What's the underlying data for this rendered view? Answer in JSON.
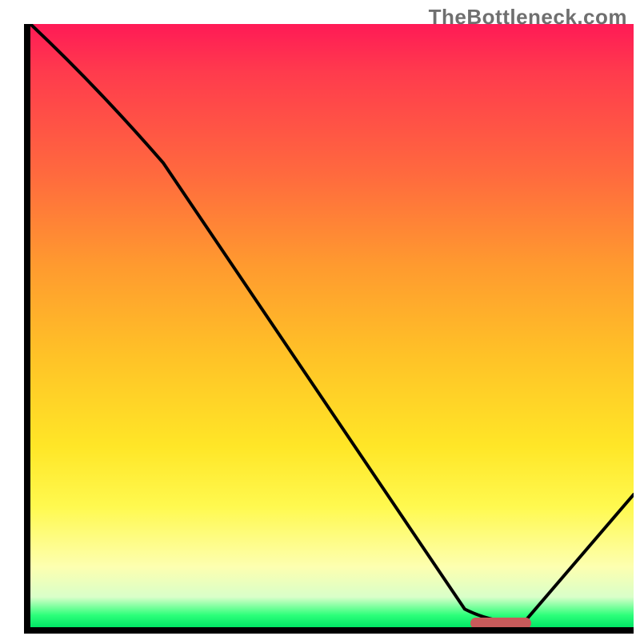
{
  "watermark": "TheBottleneck.com",
  "chart_data": {
    "type": "line",
    "title": "",
    "xlabel": "",
    "ylabel": "",
    "xlim": [
      0,
      100
    ],
    "ylim": [
      0,
      100
    ],
    "grid": false,
    "background_gradient": {
      "stops": [
        {
          "pos": 0,
          "color": "#ff1a56"
        },
        {
          "pos": 25,
          "color": "#ff6a3e"
        },
        {
          "pos": 55,
          "color": "#ffc227"
        },
        {
          "pos": 80,
          "color": "#fff94f"
        },
        {
          "pos": 95,
          "color": "#d9ffc9"
        },
        {
          "pos": 100,
          "color": "#00e765"
        }
      ]
    },
    "series": [
      {
        "name": "bottleneck-curve",
        "x": [
          0,
          22,
          72,
          82,
          100
        ],
        "y": [
          100,
          77,
          3,
          1,
          22
        ]
      }
    ],
    "marker": {
      "name": "optimal-band",
      "x_start": 73,
      "x_end": 83,
      "y": 0.6,
      "color": "#c75a5a"
    }
  }
}
